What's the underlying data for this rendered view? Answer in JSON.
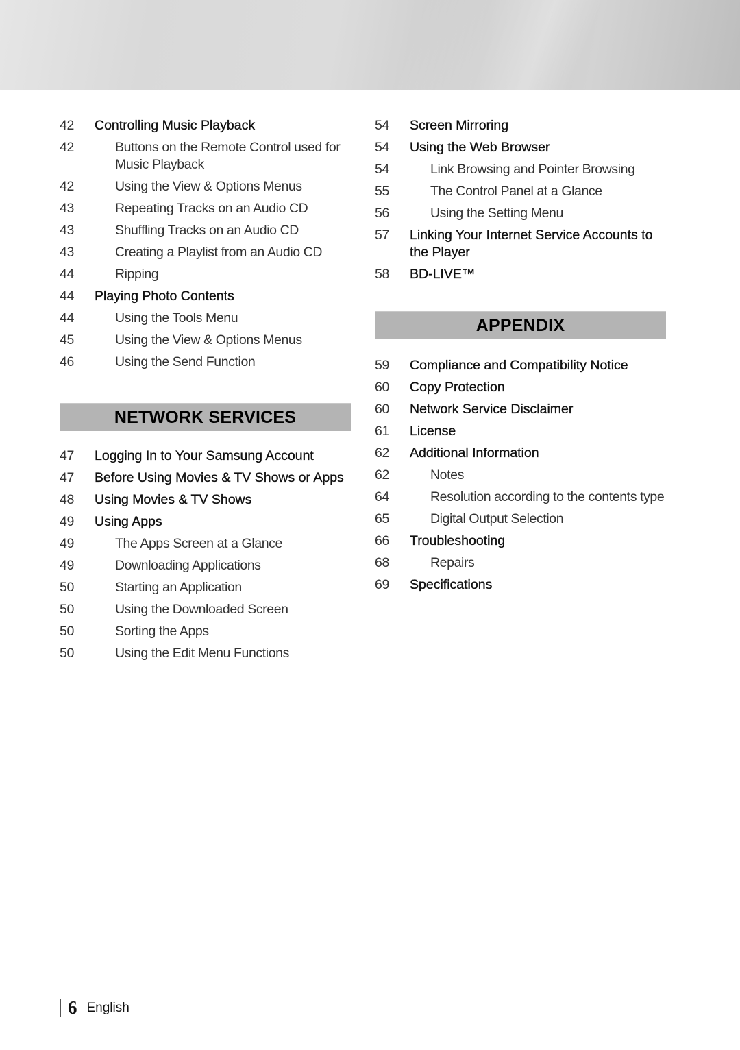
{
  "left_column": {
    "group1": [
      {
        "page": "42",
        "title": "Controlling Music Playback",
        "level": "main"
      },
      {
        "page": "42",
        "title": "Buttons on the Remote Control used for Music Playback",
        "level": "sub"
      },
      {
        "page": "42",
        "title": "Using the View & Options Menus",
        "level": "sub"
      },
      {
        "page": "43",
        "title": "Repeating Tracks on an Audio CD",
        "level": "sub"
      },
      {
        "page": "43",
        "title": "Shuffling Tracks on an Audio CD",
        "level": "sub"
      },
      {
        "page": "43",
        "title": "Creating a Playlist from an Audio CD",
        "level": "sub"
      },
      {
        "page": "44",
        "title": "Ripping",
        "level": "sub"
      },
      {
        "page": "44",
        "title": "Playing Photo Contents",
        "level": "main"
      },
      {
        "page": "44",
        "title": "Using the Tools Menu",
        "level": "sub"
      },
      {
        "page": "45",
        "title": "Using the View & Options Menus",
        "level": "sub"
      },
      {
        "page": "46",
        "title": "Using the Send Function",
        "level": "sub"
      }
    ],
    "section_title": "NETWORK SERVICES",
    "group2": [
      {
        "page": "47",
        "title": "Logging In to Your Samsung Account",
        "level": "main"
      },
      {
        "page": "47",
        "title": "Before Using Movies & TV Shows or Apps",
        "level": "main"
      },
      {
        "page": "48",
        "title": "Using Movies & TV Shows",
        "level": "main"
      },
      {
        "page": "49",
        "title": "Using Apps",
        "level": "main"
      },
      {
        "page": "49",
        "title": "The Apps Screen at a Glance",
        "level": "sub"
      },
      {
        "page": "49",
        "title": "Downloading Applications",
        "level": "sub"
      },
      {
        "page": "50",
        "title": "Starting an Application",
        "level": "sub"
      },
      {
        "page": "50",
        "title": "Using the Downloaded Screen",
        "level": "sub"
      },
      {
        "page": "50",
        "title": "Sorting the Apps",
        "level": "sub"
      },
      {
        "page": "50",
        "title": "Using the Edit Menu Functions",
        "level": "sub"
      }
    ]
  },
  "right_column": {
    "group1": [
      {
        "page": "54",
        "title": "Screen Mirroring",
        "level": "main"
      },
      {
        "page": "54",
        "title": "Using the Web Browser",
        "level": "main"
      },
      {
        "page": "54",
        "title": "Link Browsing and Pointer Browsing",
        "level": "sub"
      },
      {
        "page": "55",
        "title": "The Control Panel at a Glance",
        "level": "sub"
      },
      {
        "page": "56",
        "title": "Using the Setting Menu",
        "level": "sub"
      },
      {
        "page": "57",
        "title": "Linking Your Internet Service Accounts to the Player",
        "level": "main"
      },
      {
        "page": "58",
        "title": "BD-LIVE™",
        "level": "main"
      }
    ],
    "section_title": "APPENDIX",
    "group2": [
      {
        "page": "59",
        "title": "Compliance and Compatibility Notice",
        "level": "main"
      },
      {
        "page": "60",
        "title": "Copy Protection",
        "level": "main"
      },
      {
        "page": "60",
        "title": "Network Service Disclaimer",
        "level": "main"
      },
      {
        "page": "61",
        "title": "License",
        "level": "main"
      },
      {
        "page": "62",
        "title": "Additional Information",
        "level": "main"
      },
      {
        "page": "62",
        "title": "Notes",
        "level": "sub"
      },
      {
        "page": "64",
        "title": "Resolution according to the contents type",
        "level": "sub"
      },
      {
        "page": "65",
        "title": "Digital Output Selection",
        "level": "sub"
      },
      {
        "page": "66",
        "title": "Troubleshooting",
        "level": "main"
      },
      {
        "page": "68",
        "title": "Repairs",
        "level": "sub"
      },
      {
        "page": "69",
        "title": "Specifications",
        "level": "main"
      }
    ]
  },
  "footer": {
    "page_number": "6",
    "language": "English"
  }
}
